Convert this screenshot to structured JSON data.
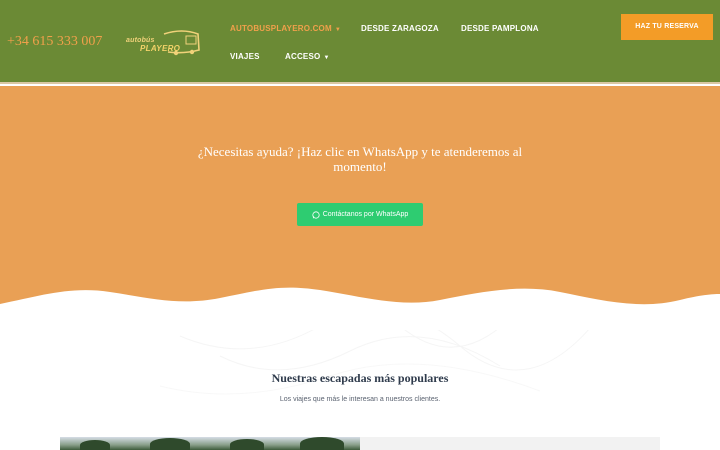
{
  "header": {
    "phone": "+34 615 333 007",
    "logo_text_top": "autobús",
    "logo_text_bottom": "PLAYERO",
    "nav": [
      {
        "label": "AUTOBUSPLAYERO.COM",
        "has_caret": true,
        "active": true
      },
      {
        "label": "DESDE ZARAGOZA",
        "has_caret": false,
        "active": false
      },
      {
        "label": "DESDE PAMPLONA",
        "has_caret": false,
        "active": false
      },
      {
        "label": "VIAJES",
        "has_caret": false,
        "active": false
      },
      {
        "label": "ACCESO",
        "has_caret": true,
        "active": false
      }
    ],
    "cta_label": "HAZ TU RESERVA"
  },
  "hero": {
    "help_text": "¿Necesitas ayuda? ¡Haz clic en WhatsApp y te atenderemos al momento!",
    "whatsapp_button": "Contáctanos por WhatsApp",
    "whatsapp_icon": "whatsapp-icon"
  },
  "popular": {
    "title": "Nuestras escapadas más populares",
    "subtitle": "Los viajes que más le interesan a nuestros clientes."
  },
  "colors": {
    "header_bg": "#6b8a35",
    "accent_orange": "#f39c27",
    "hero_bg": "#e9a055",
    "whatsapp_green": "#2ecc71"
  }
}
